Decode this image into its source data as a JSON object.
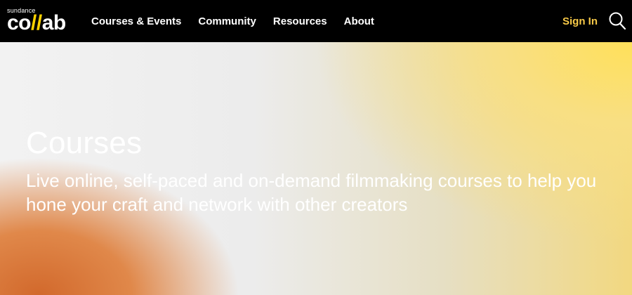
{
  "logo": {
    "small_text": "sundance",
    "part1": "co",
    "slashes": "//",
    "part2": "ab"
  },
  "nav": {
    "items": [
      {
        "label": "Courses & Events"
      },
      {
        "label": "Community"
      },
      {
        "label": "Resources"
      },
      {
        "label": "About"
      }
    ]
  },
  "header": {
    "signin_label": "Sign In",
    "search_icon": "search-icon"
  },
  "hero": {
    "title": "Courses",
    "subtitle": "Live online, self-paced and on-demand filmmaking courses to help you hone your craft and network with other creators"
  },
  "colors": {
    "accent": "#f7c948",
    "topbar": "#000000"
  }
}
